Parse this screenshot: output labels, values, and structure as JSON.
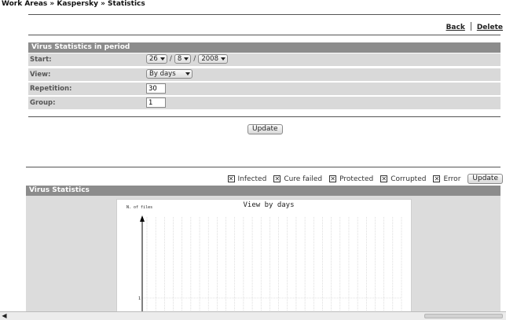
{
  "breadcrumb": "Work Areas » Kaspersky » Statistics",
  "toplinks": {
    "back": "Back",
    "delete": "Delete"
  },
  "period": {
    "header": "Virus Statistics in period",
    "start": {
      "label": "Start:",
      "day": "26",
      "month": "8",
      "year": "2008",
      "sep": "/"
    },
    "view": {
      "label": "View:",
      "value": "By days"
    },
    "repetition": {
      "label": "Repetition:",
      "value": "30"
    },
    "group": {
      "label": "Group:",
      "value": "1"
    },
    "update_label": "Update"
  },
  "legend": {
    "items": [
      {
        "label": "Infected",
        "checked": true
      },
      {
        "label": "Cure failed",
        "checked": true
      },
      {
        "label": "Protected",
        "checked": true
      },
      {
        "label": "Corrupted",
        "checked": true
      },
      {
        "label": "Error",
        "checked": true
      }
    ],
    "update_label": "Update"
  },
  "stats": {
    "header": "Virus Statistics"
  },
  "chart_data": {
    "type": "line",
    "title": "View by days",
    "ylabel": "N. of files",
    "yticks": [
      "1"
    ],
    "x_count": 30,
    "series": []
  },
  "colors": {
    "header_bg": "#8c8c8c",
    "row_bg": "#d9d9d9",
    "grid": "#c8c8c8"
  }
}
